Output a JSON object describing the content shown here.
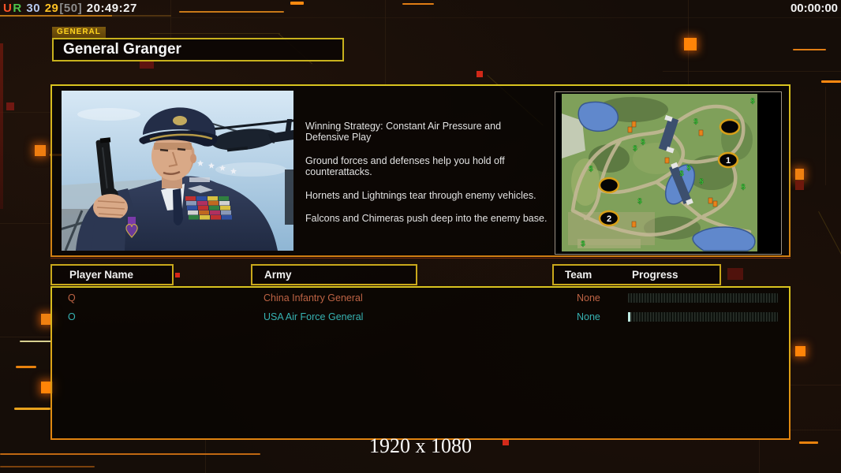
{
  "hud": {
    "u": "U",
    "r": "R",
    "v1": "30",
    "v2": "29",
    "v3": "[50]",
    "clock": "20:49:27",
    "match_timer": "00:00:00",
    "colors": {
      "u": "#ff5428",
      "r": "#4cc44c",
      "v1": "#b4c8ee",
      "v2": "#ffc224",
      "v3": "#8c8c8c",
      "clock": "#f2f2f2"
    }
  },
  "general": {
    "tab_label": "GENERAL",
    "name": "General Granger",
    "strategy": {
      "l1": "Winning Strategy: Constant Air Pressure and",
      "l2": " Defensive Play",
      "l3": "Ground forces and defenses help you hold off",
      "l4": " counterattacks.",
      "l5": "Hornets and Lightnings tear through enemy vehicles.",
      "l6": "Falcons and Chimeras push deep into the enemy base."
    }
  },
  "map": {
    "start_marker_1": "1",
    "start_marker_2": "2",
    "supply_symbol": "$"
  },
  "table": {
    "headers": {
      "player_name": "Player Name",
      "army": "Army",
      "team": "Team",
      "progress": "Progress"
    },
    "rows": [
      {
        "name": "Q",
        "army": "China Infantry General",
        "team": "None",
        "color": "#bd6344"
      },
      {
        "name": "O",
        "army": "USA Air Force General",
        "team": "None",
        "color": "#36b2b2"
      }
    ]
  },
  "footer": {
    "resolution": "1920 x 1080"
  },
  "colors": {
    "accent_yellow": "#d8c31f",
    "accent_orange": "#f08418"
  }
}
